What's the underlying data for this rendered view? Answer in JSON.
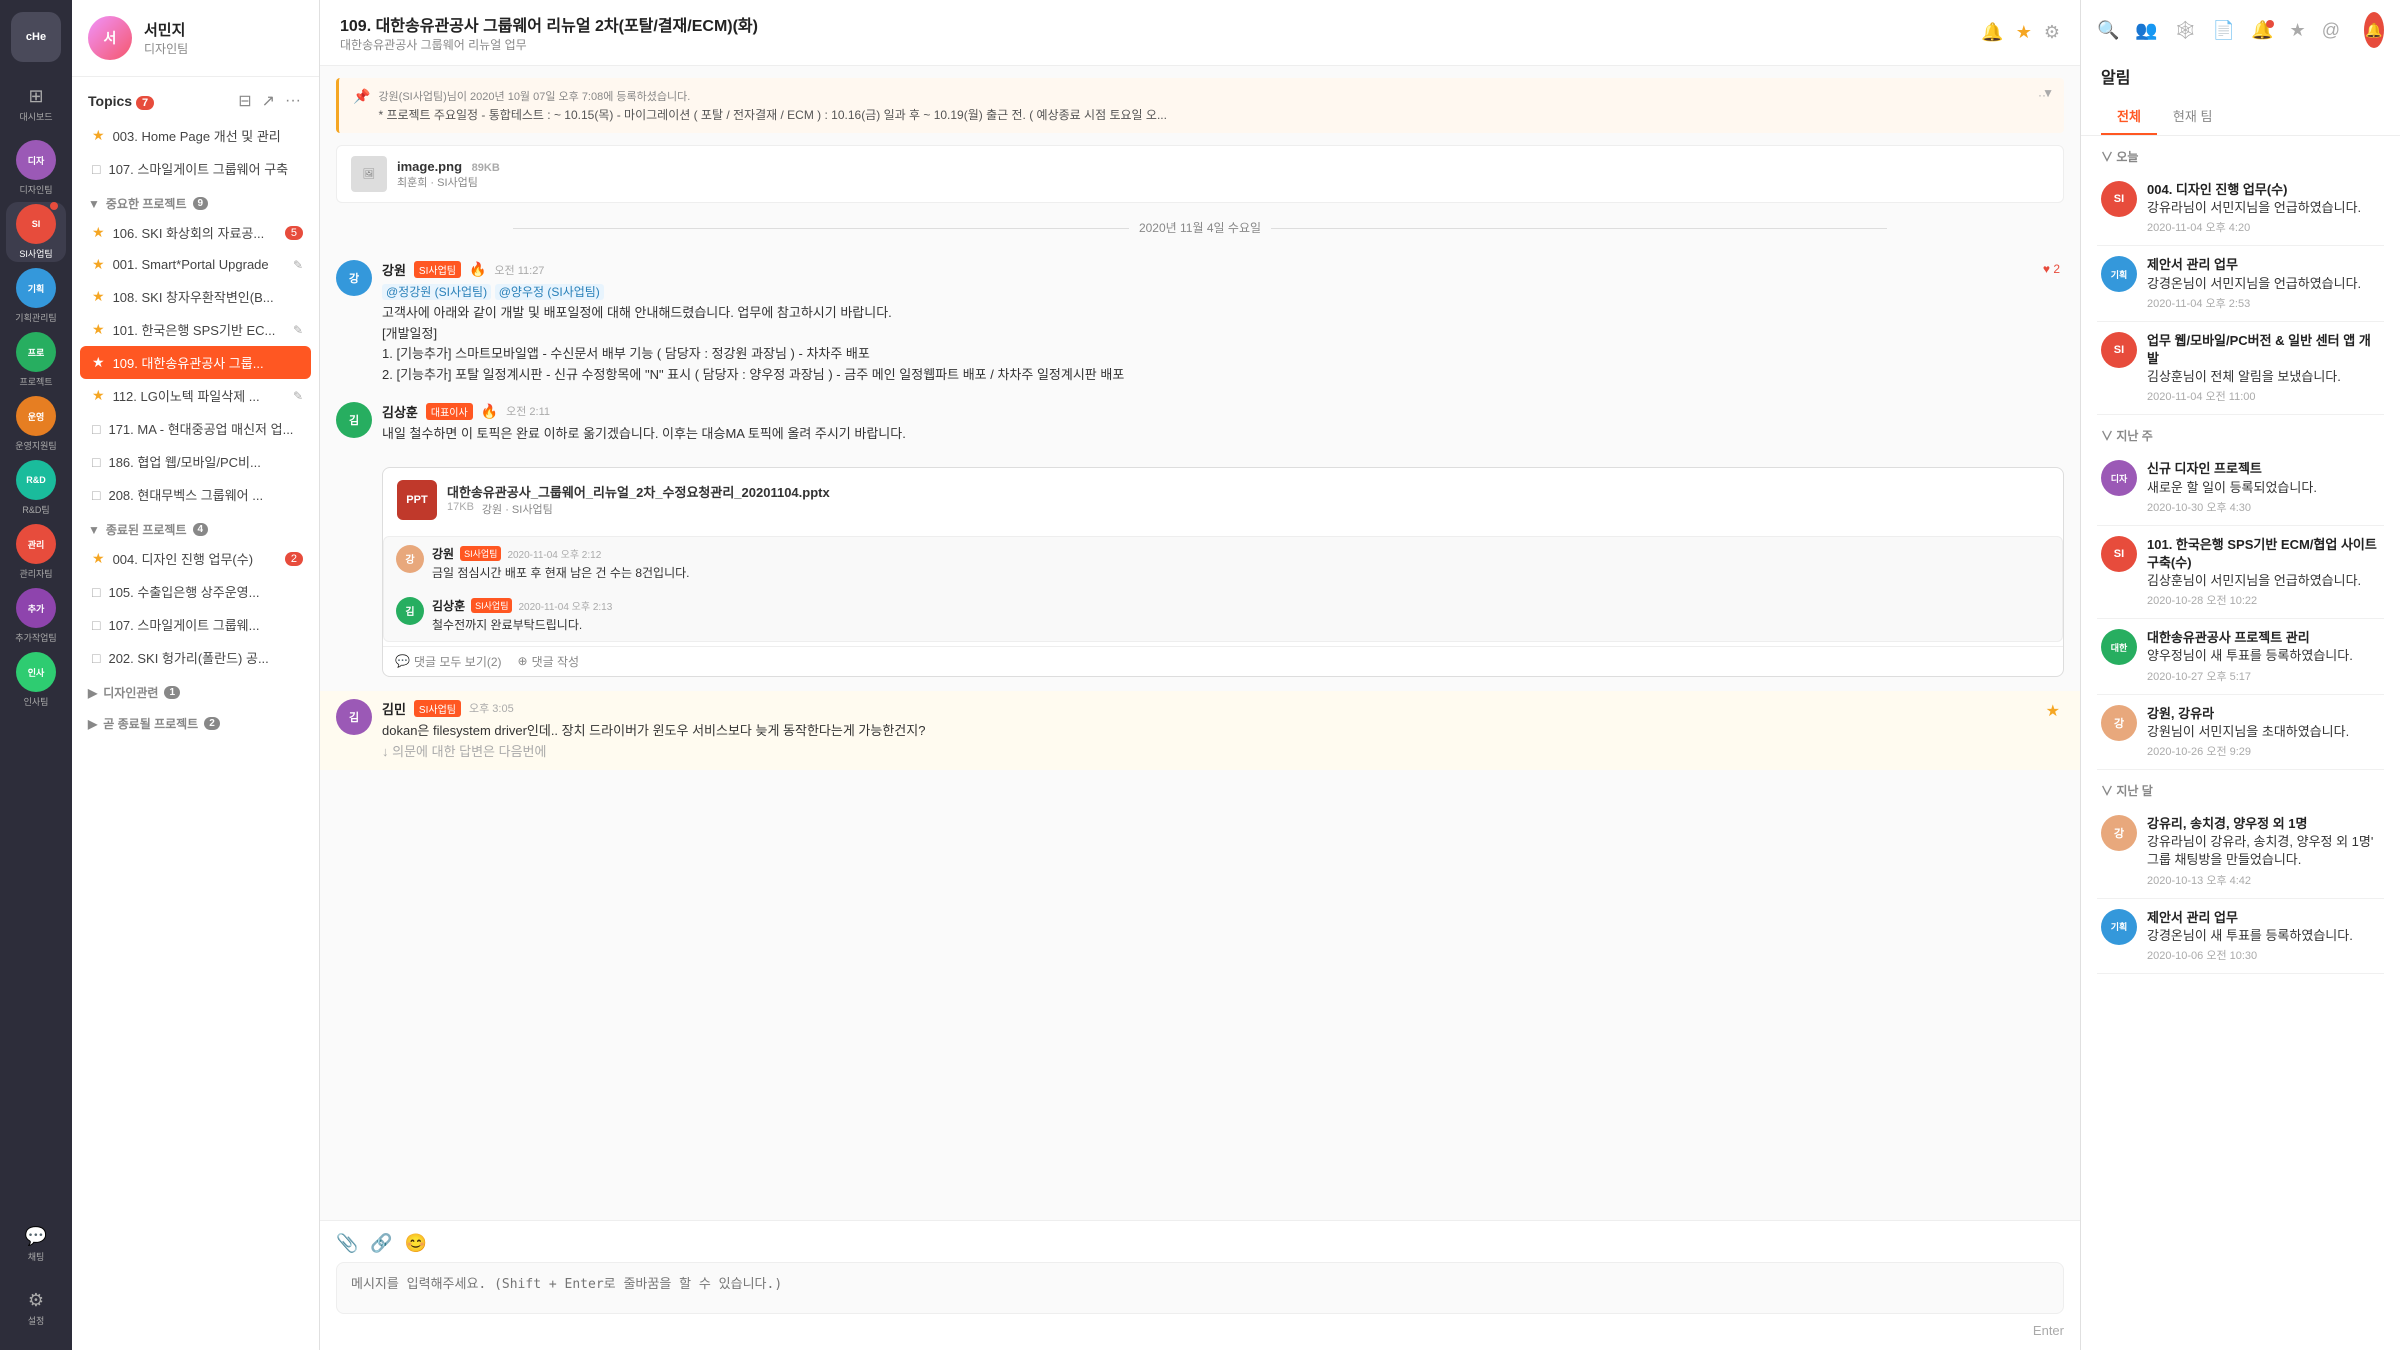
{
  "nav": {
    "logo": "cHe",
    "items": [
      {
        "id": "dashboard",
        "label": "대시보드",
        "icon": "⊞",
        "active": false
      },
      {
        "id": "design",
        "label": "디자인팀",
        "icon": "🎨",
        "active": false,
        "color": "#9b59b6"
      },
      {
        "id": "si",
        "label": "SI사업팀",
        "icon": "SI",
        "active": true,
        "color": "#e74c3c"
      },
      {
        "id": "planning",
        "label": "기획관리팀",
        "icon": "기획",
        "active": false,
        "color": "#3498db"
      },
      {
        "id": "project",
        "label": "프로젝트",
        "icon": "프로",
        "active": false,
        "color": "#27ae60"
      },
      {
        "id": "operations",
        "label": "운영지원팀",
        "icon": "운영",
        "active": false,
        "color": "#e67e22"
      },
      {
        "id": "rnd",
        "label": "R&D팀",
        "icon": "R&D",
        "active": false,
        "color": "#1abc9c"
      },
      {
        "id": "management",
        "label": "관리자팀",
        "icon": "관리",
        "active": false,
        "color": "#e74c3c"
      },
      {
        "id": "extra",
        "label": "추가작업팀",
        "icon": "추가",
        "active": false,
        "color": "#8e44ad"
      },
      {
        "id": "hr",
        "label": "인사팀",
        "icon": "인사",
        "active": false,
        "color": "#2ecc71"
      },
      {
        "id": "settings",
        "label": "설정",
        "icon": "⚙",
        "active": false
      },
      {
        "id": "chat",
        "label": "채팅",
        "icon": "💬",
        "active": false
      }
    ]
  },
  "sidebar": {
    "user": {
      "name": "서민지",
      "team": "디자인팀",
      "avatar_initials": "서"
    },
    "topics_label": "Topics",
    "topics_count": 7,
    "pinned_items": [
      {
        "label": "003. Home Page 개선 및 관리",
        "type": "star"
      },
      {
        "label": "107. 스마일게이트 그룹웨어 구축",
        "type": "doc"
      }
    ],
    "section_important": {
      "label": "중요한 프로젝트",
      "count": 9,
      "items": [
        {
          "label": "106. SKI 화상회의 자료공...",
          "type": "star",
          "badge": "5"
        },
        {
          "label": "001. Smart*Portal Upgrade",
          "type": "star",
          "edit": true
        },
        {
          "label": "108. SKI 창자우환작변인(B...",
          "type": "star"
        },
        {
          "label": "101. 한국은행 SPS기반 EC...",
          "type": "star",
          "edit": true
        },
        {
          "label": "109. 대한송유관공사 그룹...",
          "type": "star",
          "active": true
        },
        {
          "label": "112. LG이노텍 파일삭제 ...",
          "type": "star",
          "edit": true
        },
        {
          "label": "171. MA - 현대중공업 매신저 업...",
          "type": "doc"
        },
        {
          "label": "186. 협업 웹/모바일/PC비...",
          "type": "doc"
        },
        {
          "label": "208. 현대무벡스 그룹웨어 ...",
          "type": "doc"
        }
      ]
    },
    "section_completed": {
      "label": "종료된 프로젝트",
      "count": 4,
      "items": [
        {
          "label": "004. 디자인 진행 업무(수)",
          "type": "star",
          "badge": "2"
        },
        {
          "label": "105. 수출입은행 상주운영...",
          "type": "doc"
        },
        {
          "label": "107. 스마일게이트 그룹웨...",
          "type": "doc"
        },
        {
          "label": "202. SKI 헝가리(폴란드) 공...",
          "type": "doc"
        }
      ]
    },
    "section_design": {
      "label": "디자인관련",
      "count": 1
    },
    "section_soon": {
      "label": "곧 종료될 프로젝트",
      "count": 2
    }
  },
  "chat": {
    "title": "109. 대한송유관공사 그룹웨어 리뉴얼 2차(포탈/결재/ECM)(화)",
    "subtitle": "대한송유관공사 그룹웨어 리뉴얼 업무",
    "notification": {
      "author": "강원(SI사업팀)님이 2020년 10월 07일 오후 7:08에 등록하셨습니다.",
      "content": "* 프로젝트 주요일정 - 통합테스트 : ~ 10.15(목) - 마이그레이션 ( 포탈 / 전자결재 / ECM ) : 10.16(금) 일과 후 ~ 10.19(월) 출근 전. ( 예상종료 시점 토요일 오..."
    },
    "attachment": {
      "name": "image.png",
      "size": "89KB",
      "uploader": "최훈희 · SI사업팀"
    },
    "date_separator": "2020년 11월 4일 수요일",
    "messages": [
      {
        "id": "msg1",
        "author": "강원",
        "team": "SI사업팀",
        "time": "오전 11:27",
        "tags": [
          "@정강원 (SI사업팀)",
          "@양우정 (SI사업팀)"
        ],
        "text_lines": [
          "고객사에 아래와 같이 개발 및 배포일정에 대해 안내해드렸습니다. 업무에 참고하시기 바랍니다.",
          "[개발일정]",
          "1. [기능추가] 스마트모바일앱 - 수신문서 배부 기능 ( 담당자 : 정강원 과장님 ) - 차차주 배포",
          "2. [기능추가] 포탈 일정계시판 - 신규 수정항목에 \"N\" 표시 ( 담당자 : 양우정 과장님 ) - 금주 메인 일정웹파트 배포 / 차차주 일정계시판 배포"
        ],
        "reaction": "♥ 2",
        "avatar_color": "#3498db",
        "avatar_initials": "강"
      },
      {
        "id": "msg2",
        "author": "김상훈",
        "team": "대표이사",
        "time": "오전 2:11",
        "text_lines": [
          "내일 철수하면 이 토픽은 완료 이하로 옮기겠습니다. 이후는 대승MA 토픽에 올려 주시기 바랍니다."
        ],
        "avatar_color": "#27ae60",
        "avatar_initials": "김"
      },
      {
        "id": "msg3_file",
        "author": "강원",
        "team": "SI사업팀",
        "file_name": "대한송유관공사_그룹웨어_리뉴얼_2차_수정요청관리_20201104.pptx",
        "file_size": "17KB",
        "file_uploader": "강원 · SI사업팀",
        "avatar_color": "#3498db",
        "avatar_initials": "강",
        "sub_replies": [
          {
            "author": "강원",
            "team": "SI사업팀",
            "time": "2020-11-04 오후 2:12",
            "text": "금일 점심시간 배포 후 현재 남은 건 수는 8건입니다.",
            "avatar_color": "#e8a87c",
            "avatar_initials": "강"
          },
          {
            "author": "김상훈",
            "team": "SI사업팀",
            "time": "2020-11-04 오후 2:13",
            "text": "철수전까지 완료부탁드립니다.",
            "avatar_color": "#27ae60",
            "avatar_initials": "김"
          }
        ],
        "reply_count": 2
      },
      {
        "id": "msg4",
        "author": "김민",
        "team": "SI사업팀",
        "time": "오후 3:05",
        "text_lines": [
          "dokan은 filesystem driver인데.. 장치 드라이버가 윈도우 서비스보다 늦게 동작한다는게 가능한건지?",
          "↓ 의문에 대한 답변은 다음번에"
        ],
        "star": true,
        "avatar_color": "#9b59b6",
        "avatar_initials": "김"
      }
    ],
    "input": {
      "placeholder": "메시지를 입력해주세요. (Shift + Enter로 줄바꿈을 할 수 있습니다.)",
      "send_label": "Enter"
    }
  },
  "notifications": {
    "title": "알림",
    "tabs": [
      "전체",
      "현재 팀"
    ],
    "active_tab": "전체",
    "sections": [
      {
        "title": "오늘",
        "items": [
          {
            "avatar_color": "#e74c3c",
            "avatar_initials": "SI",
            "title": "004. 디자인 진행 업무(수)",
            "subtitle": "강유라님이 서민지님을 언급하였습니다.",
            "time": "2020-11-04 오후 4:20"
          },
          {
            "avatar_color": "#3498db",
            "avatar_initials": "기획",
            "title": "제안서 관리 업무",
            "subtitle": "강경온님이 서민지님을 언급하였습니다.",
            "time": "2020-11-04 오후 2:53"
          },
          {
            "avatar_color": "#e74c3c",
            "avatar_initials": "SI",
            "title": "업무 웹/모바일/PC버전 & 일반 센터 앱 개발",
            "subtitle": "김상훈님이 전체 알림을 보냈습니다.",
            "time": "2020-11-04 오전 11:00"
          }
        ]
      },
      {
        "title": "지난 주",
        "items": [
          {
            "avatar_color": "#9b59b6",
            "avatar_initials": "디자",
            "title": "신규 디자인 프로젝트",
            "subtitle": "새로운 할 일이 등록되었습니다.",
            "time": "2020-10-30 오후 4:30"
          },
          {
            "avatar_color": "#e74c3c",
            "avatar_initials": "SI",
            "title": "101. 한국은행 SPS기반 ECM/협업 사이트 구축(수)",
            "subtitle": "김상훈님이 서민지님을 언급하였습니다.",
            "time": "2020-10-28 오전 10:22"
          },
          {
            "avatar_color": "#27ae60",
            "avatar_initials": "대한",
            "title": "대한송유관공사 프로젝트 관리",
            "subtitle": "양우정님이 새 투표를 등록하였습니다.",
            "time": "2020-10-27 오후 5:17"
          },
          {
            "avatar_color": "#e8a87c",
            "avatar_initials": "강",
            "title": "강원, 강유라",
            "subtitle": "강원님이 서민지님을 초대하였습니다.",
            "time": "2020-10-26 오전 9:29"
          }
        ]
      },
      {
        "title": "지난 달",
        "items": [
          {
            "avatar_color": "#e8a87c",
            "avatar_initials": "강",
            "title": "강유리, 송치경, 양우정 외 1명",
            "subtitle": "강유라님이 강유라, 송치경, 양우정 외 1명' 그룹 채팅방을 만들었습니다.",
            "time": "2020-10-13 오후 4:42"
          },
          {
            "avatar_color": "#3498db",
            "avatar_initials": "기획",
            "title": "제안서 관리 업무",
            "subtitle": "강경온님이 새 투표를 등록하였습니다.",
            "time": "2020-10-06 오전 10:30"
          }
        ]
      }
    ]
  }
}
